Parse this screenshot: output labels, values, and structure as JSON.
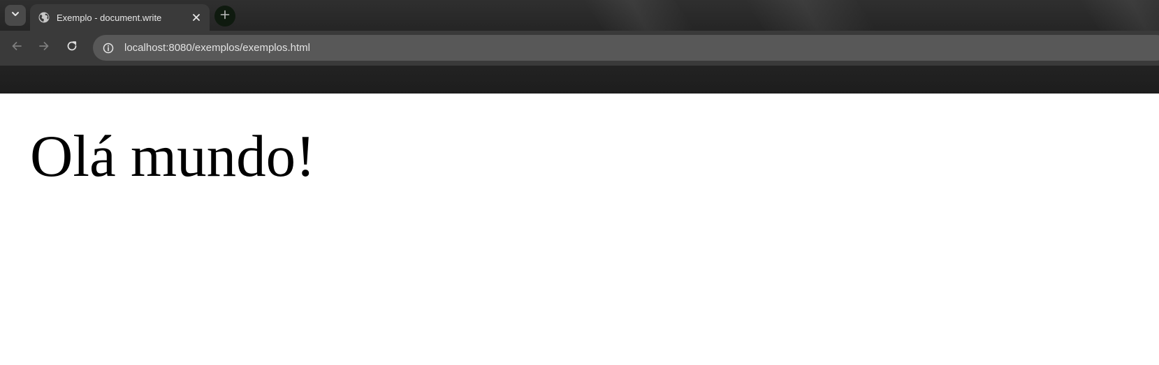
{
  "browser": {
    "tab": {
      "title": "Exemplo - document.write",
      "favicon": "globe-icon",
      "close_icon": "close-icon"
    },
    "tab_search_icon": "chevron-down-icon",
    "new_tab_icon": "plus-icon",
    "toolbar": {
      "back_icon": "arrow-left-icon",
      "forward_icon": "arrow-right-icon",
      "reload_icon": "reload-icon",
      "site_info_icon": "info-icon",
      "url": "localhost:8080/exemplos/exemplos.html"
    }
  },
  "page": {
    "heading": "Olá mundo!"
  }
}
